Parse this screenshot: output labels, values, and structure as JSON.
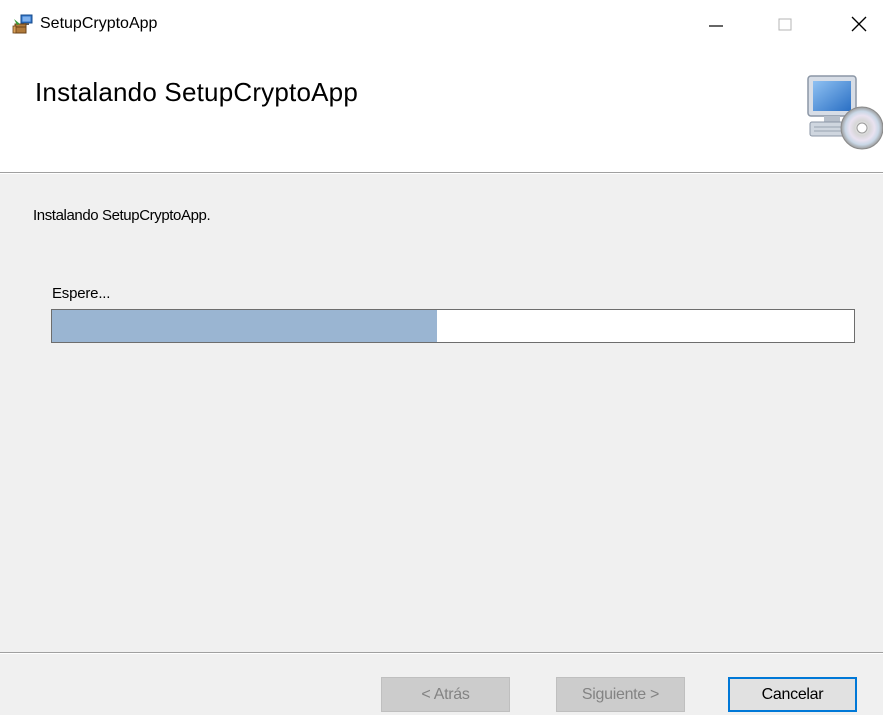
{
  "window": {
    "title": "SetupCryptoApp",
    "icons": {
      "app": "installer-icon",
      "minimize": "minimize-icon",
      "maximize": "maximize-icon",
      "close": "close-icon"
    }
  },
  "header": {
    "title": "Instalando SetupCryptoApp",
    "graphic": "computer-cd-icon"
  },
  "content": {
    "status": "Instalando SetupCryptoApp.",
    "wait_label": "Espere...",
    "progress_percent": 48,
    "progress_color": "#9ab5d2"
  },
  "buttons": {
    "back": "< Atrás",
    "next": "Siguiente >",
    "cancel": "Cancelar"
  },
  "colors": {
    "body_background": "#f0f0f0",
    "focus_border": "#0078d7",
    "disabled_text": "#838383"
  }
}
